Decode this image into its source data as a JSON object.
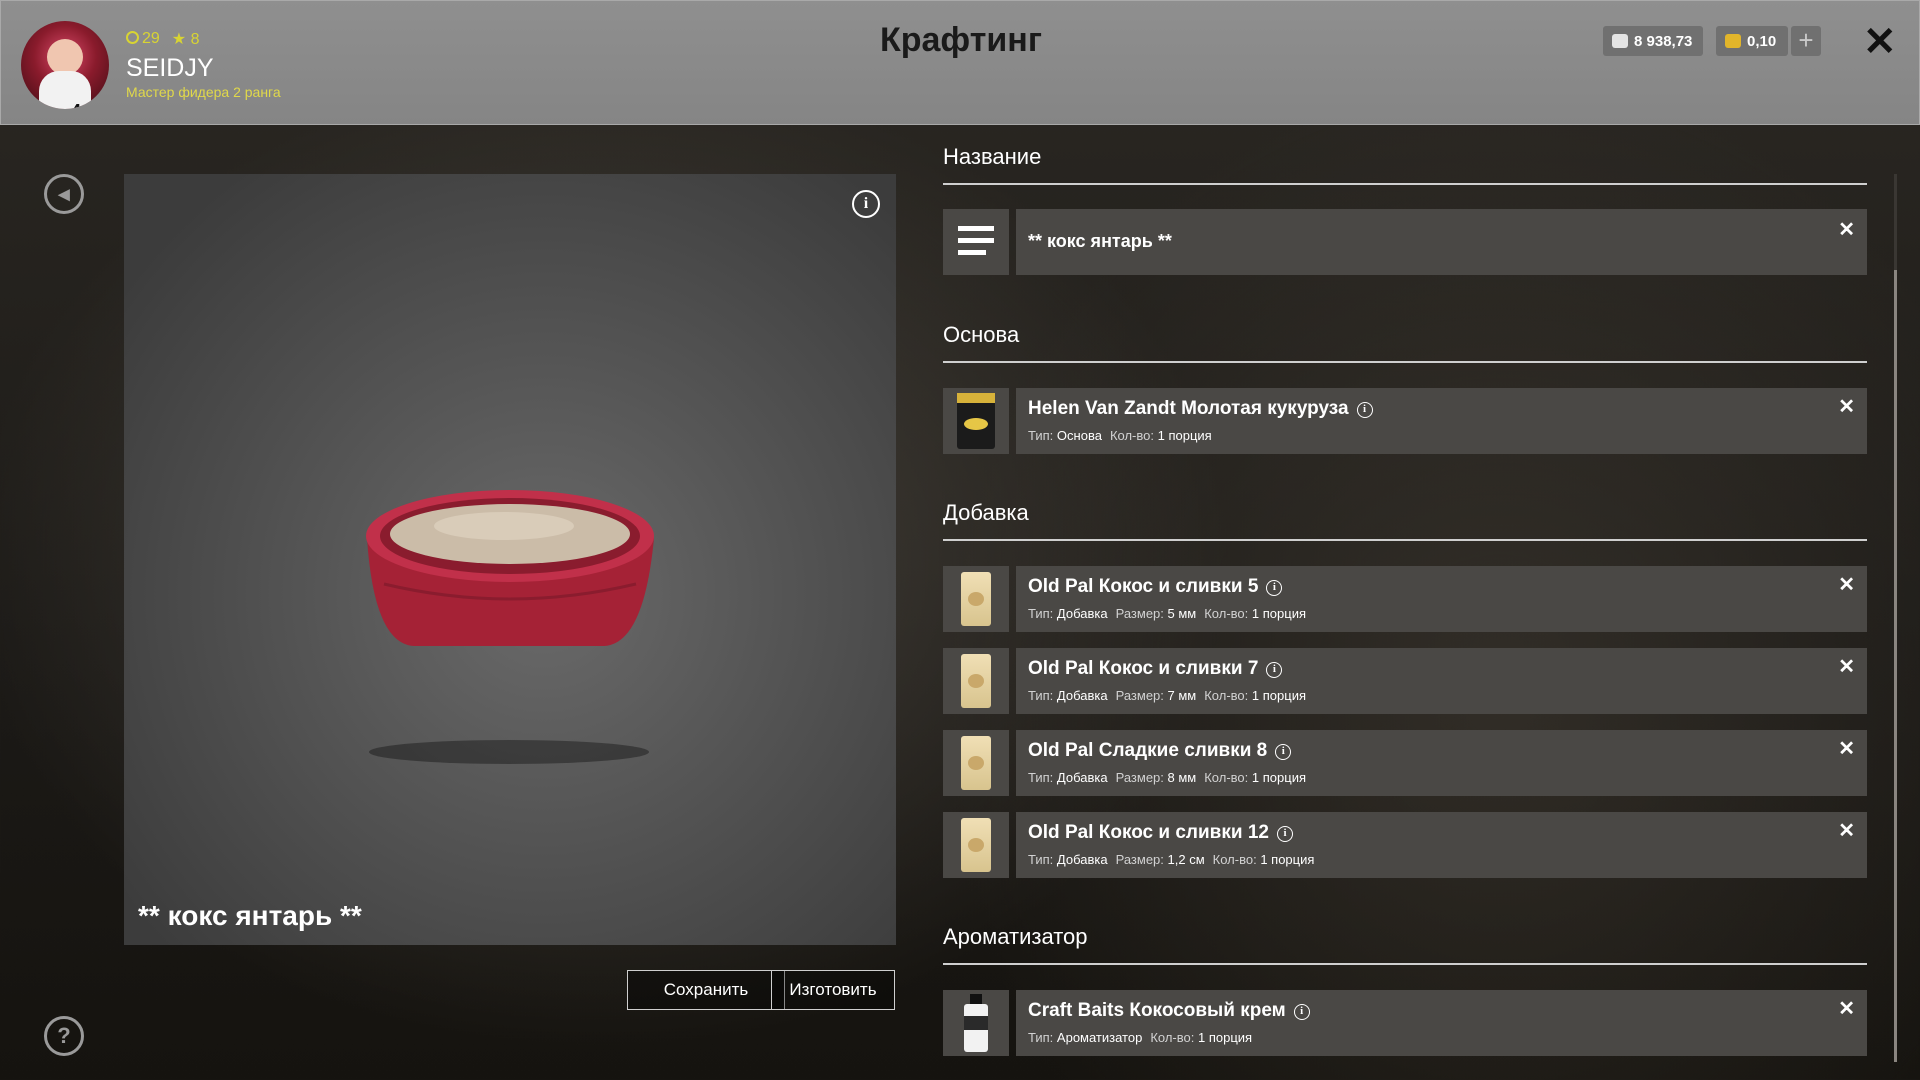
{
  "header": {
    "title": "Крафтинг",
    "player": {
      "level": "4",
      "coins_stat": "29",
      "stars_stat": "8",
      "username": "SEIDJY",
      "rank": "Мастер фидера 2 ранга"
    },
    "currency_silver": "8 938,73",
    "currency_gold": "0,10",
    "plus_label": "+",
    "close_label": "✕"
  },
  "preview": {
    "info_label": "i",
    "item_name": "** кокс янтарь **"
  },
  "buttons": {
    "save": "Сохранить",
    "craft": "Изготовить"
  },
  "sections": {
    "name": {
      "title": "Название",
      "value": "** кокс янтарь **"
    },
    "base": {
      "title": "Основа",
      "item": {
        "name": "Helen Van Zandt Молотая кукуруза",
        "type_label": "Тип:",
        "type_value": "Основа",
        "qty_label": "Кол-во:",
        "qty_value": "1 порция"
      }
    },
    "additive": {
      "title": "Добавка",
      "items": [
        {
          "name": "Old Pal Кокос и сливки 5",
          "type_label": "Тип:",
          "type_value": "Добавка",
          "size_label": "Размер:",
          "size_value": "5 мм",
          "qty_label": "Кол-во:",
          "qty_value": "1 порция"
        },
        {
          "name": "Old Pal Кокос и сливки 7",
          "type_label": "Тип:",
          "type_value": "Добавка",
          "size_label": "Размер:",
          "size_value": "7 мм",
          "qty_label": "Кол-во:",
          "qty_value": "1 порция"
        },
        {
          "name": "Old Pal Сладкие сливки 8",
          "type_label": "Тип:",
          "type_value": "Добавка",
          "size_label": "Размер:",
          "size_value": "8 мм",
          "qty_label": "Кол-во:",
          "qty_value": "1 порция"
        },
        {
          "name": "Old Pal Кокос и сливки 12",
          "type_label": "Тип:",
          "type_value": "Добавка",
          "size_label": "Размер:",
          "size_value": "1,2 см",
          "qty_label": "Кол-во:",
          "qty_value": "1 порция"
        }
      ]
    },
    "flavor": {
      "title": "Ароматизатор",
      "item": {
        "name": "Craft Baits Кокосовый крем",
        "type_label": "Тип:",
        "type_value": "Ароматизатор",
        "qty_label": "Кол-во:",
        "qty_value": "1 порция"
      }
    }
  },
  "icons": {
    "back": "back-icon",
    "help": "help-icon",
    "info": "info-icon",
    "remove": "close-icon",
    "menu": "hamburger-icon"
  },
  "colors": {
    "header_bg": "#888888",
    "accent_yellow": "#d8d433",
    "row_bg": "#4a4845",
    "bowl_red": "#b0283c"
  }
}
